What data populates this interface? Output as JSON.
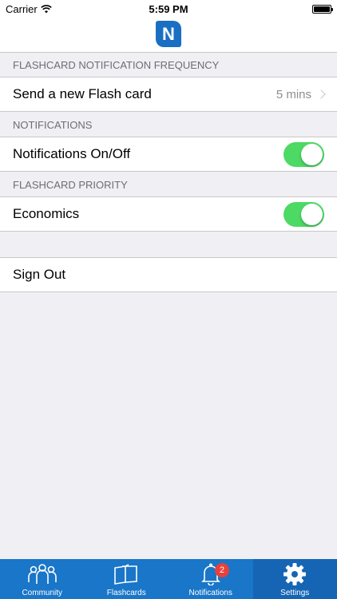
{
  "status_bar": {
    "carrier": "Carrier",
    "time": "5:59 PM"
  },
  "nav": {
    "logo_letter": "N",
    "logo_color": "#1a6fc2"
  },
  "sections": {
    "frequency": {
      "header": "FLASHCARD NOTIFICATION FREQUENCY",
      "row_label": "Send a new Flash card",
      "row_detail": "5 mins"
    },
    "notifications": {
      "header": "NOTIFICATIONS",
      "row_label": "Notifications On/Off",
      "toggle_on": true
    },
    "priority": {
      "header": "FLASHCARD PRIORITY",
      "row_label": "Economics",
      "toggle_on": true
    },
    "account": {
      "sign_out_label": "Sign Out"
    }
  },
  "tab_bar": {
    "tabs": [
      {
        "label": "Community",
        "icon": "community-icon"
      },
      {
        "label": "Flashcards",
        "icon": "flashcards-icon"
      },
      {
        "label": "Notifications",
        "icon": "bell-icon",
        "badge": "2"
      },
      {
        "label": "Settings",
        "icon": "gear-icon",
        "active": true
      }
    ]
  },
  "colors": {
    "tab_bar_bg": "#1976c8",
    "toggle_on": "#4cd964",
    "badge": "#e8403a",
    "background": "#efeff4"
  }
}
